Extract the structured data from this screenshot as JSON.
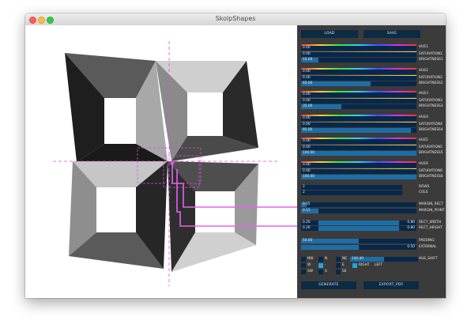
{
  "window": {
    "title": "SkolpShapes"
  },
  "buttons": {
    "load": "LOAD",
    "save": "SAVE",
    "generate": "GENERATE",
    "export_pdf": "EXPORT_PDF"
  },
  "colors": [
    {
      "hue_label": "HUE1",
      "hue_value": "0.00",
      "sat_label": "SATURATION1",
      "sat_value": "0.00",
      "bri_label": "BRIGHTNESS1",
      "bri_value": "15.00",
      "bri_fraction": 0.15
    },
    {
      "hue_label": "HUE2",
      "hue_value": "0.00",
      "sat_label": "SATURATION2",
      "sat_value": "0.00",
      "bri_label": "BRIGHTNESS2",
      "bri_value": "60.00",
      "bri_fraction": 0.6
    },
    {
      "hue_label": "HUE3",
      "hue_value": "0.00",
      "sat_label": "SATURATION3",
      "sat_value": "0.00",
      "bri_label": "BRIGHTNESS3",
      "bri_value": "35.00",
      "bri_fraction": 0.35
    },
    {
      "hue_label": "HUE4",
      "hue_value": "0.00",
      "sat_label": "SATURATION4",
      "sat_value": "0.00",
      "bri_label": "BRIGHTNESS4",
      "bri_value": "95.00",
      "bri_fraction": 0.95
    },
    {
      "hue_label": "HUE5",
      "hue_value": "0.00",
      "sat_label": "SATURATION5",
      "sat_value": "0.00",
      "bri_label": "BRIGHTNESS5",
      "bri_value": "100.00",
      "bri_fraction": 1.0
    },
    {
      "hue_label": "HUE6",
      "hue_value": "0.00",
      "sat_label": "SATURATION6",
      "sat_value": "0.00",
      "bri_label": "BRIGHTNESS6",
      "bri_value": "100.00",
      "bri_fraction": 1.0
    }
  ],
  "grid": {
    "rows_label": "ROWS",
    "rows_value": "2",
    "cols_label": "COLS",
    "cols_value": "2"
  },
  "margins": {
    "rect_label": "MARGIN_RECT",
    "rect_value": "0.05",
    "rect_fraction": 0.05,
    "point_label": "MARGIN_POINT",
    "point_value": "0.15",
    "point_fraction": 0.15
  },
  "rect_size": {
    "width_label": "RECT_WIDTH",
    "width_min": "0.20",
    "width_max": "0.80",
    "height_label": "RECT_HEIGHT",
    "height_min": "0.20",
    "height_max": "0.80"
  },
  "padding": {
    "label": "PADDING",
    "value": "50.00",
    "fraction": 0.5,
    "external_label": "EXTERNAL",
    "external_value": "0.50",
    "external_fraction": 0.5
  },
  "directions": {
    "nw": "NW",
    "n": "N",
    "ne": "NE",
    "w": "W",
    "dash": "-",
    "e": "E",
    "sw": "SW",
    "s": "S",
    "se": "SE"
  },
  "hue_shift": {
    "label": "HUE_SHIFT",
    "value": "100.00",
    "fraction": 0.5
  },
  "right_toggle": "RIGHT",
  "left_label": "LEFT"
}
